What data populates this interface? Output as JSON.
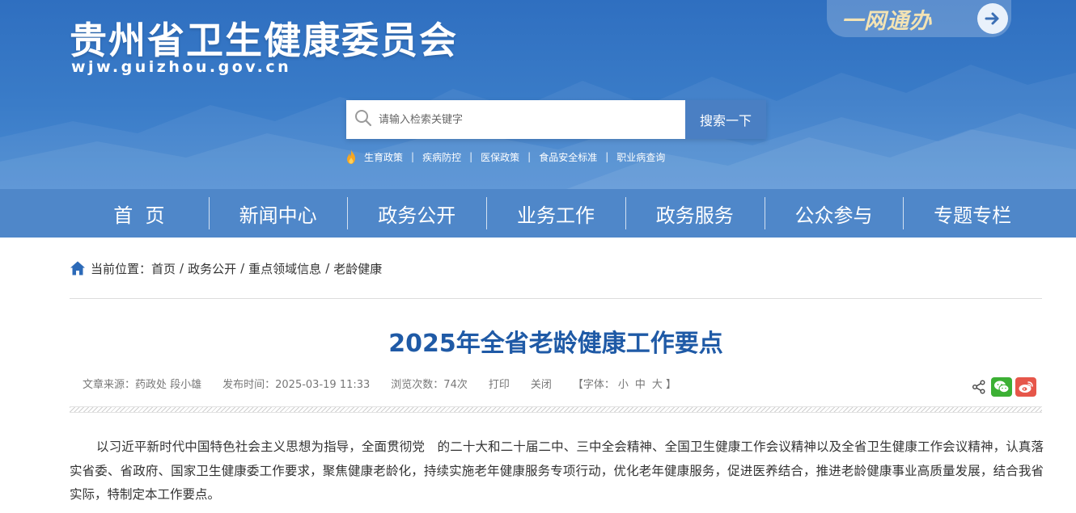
{
  "header": {
    "site_title": "贵州省卫生健康委员会",
    "site_url": "wjw.guizhou.gov.cn",
    "yiwang_label": "一网通办",
    "search_placeholder": "请输入检索关键字",
    "search_button": "搜索一下",
    "hot_links": [
      "生育政策",
      "疾病防控",
      "医保政策",
      "食品安全标准",
      "职业病查询"
    ],
    "hot_separator": "|"
  },
  "nav": {
    "items": [
      "首  页",
      "新闻中心",
      "政务公开",
      "业务工作",
      "政务服务",
      "公众参与",
      "专题专栏"
    ]
  },
  "breadcrumb": {
    "prefix": "当前位置：",
    "items": [
      "首页",
      "政务公开",
      "重点领域信息",
      "老龄健康"
    ],
    "separator": "/"
  },
  "article": {
    "title": "2025年全省老龄健康工作要点",
    "meta": {
      "source": "文章来源：药政处 段小雄",
      "publish_time": "发布时间：2025-03-19 11:33",
      "views": "浏览次数：74次",
      "print": "打印",
      "close": "关闭",
      "font_prefix": "【字体：",
      "font_small": "小",
      "font_medium": "中",
      "font_large": "大",
      "font_suffix": "】"
    },
    "body": "以习近平新时代中国特色社会主义思想为指导，全面贯彻党　的二十大和二十届二中、三中全会精神、全国卫生健康工作会议精神以及全省卫生健康工作会议精神，认真落实省委、省政府、国家卫生健康委工作要求，聚焦健康老龄化，持续实施老年健康服务专项行动，优化老年健康服务，促进医养结合，推进老龄健康事业高质量发展，结合我省实际，特制定本工作要点。"
  },
  "colors": {
    "header_blue": "#3a7cc8",
    "nav_blue": "#4f87c9",
    "title_blue": "#1f5aa6",
    "search_button": "#4a7fc3",
    "wechat_green": "#3cb034",
    "weibo_red": "#e6564a"
  },
  "icons": [
    "search-icon",
    "arrow-right-icon",
    "fire-icon",
    "home-icon",
    "share-icon",
    "wechat-icon",
    "weibo-icon"
  ]
}
